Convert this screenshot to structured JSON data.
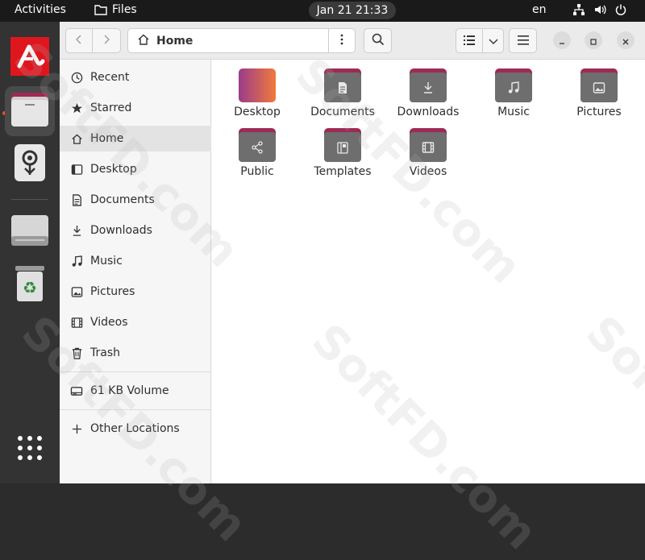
{
  "topbar": {
    "activities": "Activities",
    "app_name": "Files",
    "clock": "Jan 21  21:33",
    "lang": "en"
  },
  "dock": {
    "items": [
      {
        "name": "Avira",
        "icon": "avira-icon"
      },
      {
        "name": "Files",
        "icon": "folder-icon"
      },
      {
        "name": "Map marker",
        "icon": "map-pin-icon"
      },
      {
        "name": "Drive",
        "icon": "drive-icon"
      },
      {
        "name": "Trash",
        "icon": "trash-recycle-icon"
      },
      {
        "name": "Show Applications",
        "icon": "app-grid-icon"
      }
    ],
    "accent": "#e95420"
  },
  "headerbar": {
    "path": "Home"
  },
  "sidebar": {
    "items": [
      {
        "label": "Recent",
        "icon": "clock-icon"
      },
      {
        "label": "Starred",
        "icon": "star-icon"
      },
      {
        "label": "Home",
        "icon": "home-icon",
        "active": true
      },
      {
        "label": "Desktop",
        "icon": "desktop-icon"
      },
      {
        "label": "Documents",
        "icon": "document-icon"
      },
      {
        "label": "Downloads",
        "icon": "download-icon"
      },
      {
        "label": "Music",
        "icon": "music-icon"
      },
      {
        "label": "Pictures",
        "icon": "picture-icon"
      },
      {
        "label": "Videos",
        "icon": "video-icon"
      },
      {
        "label": "Trash",
        "icon": "trash-icon"
      }
    ],
    "volume": "61 KB Volume",
    "other": "Other Locations"
  },
  "files": [
    {
      "label": "Desktop",
      "icon": "desktop-folder-icon"
    },
    {
      "label": "Documents",
      "icon": "documents-folder-icon"
    },
    {
      "label": "Downloads",
      "icon": "downloads-folder-icon"
    },
    {
      "label": "Music",
      "icon": "music-folder-icon"
    },
    {
      "label": "Pictures",
      "icon": "pictures-folder-icon"
    },
    {
      "label": "Public",
      "icon": "public-folder-icon"
    },
    {
      "label": "Templates",
      "icon": "templates-folder-icon"
    },
    {
      "label": "Videos",
      "icon": "videos-folder-icon"
    }
  ],
  "watermark": "SoftFD.com",
  "colors": {
    "folder_tab": "#9e2a55",
    "folder_body": "#6e6e6e"
  }
}
